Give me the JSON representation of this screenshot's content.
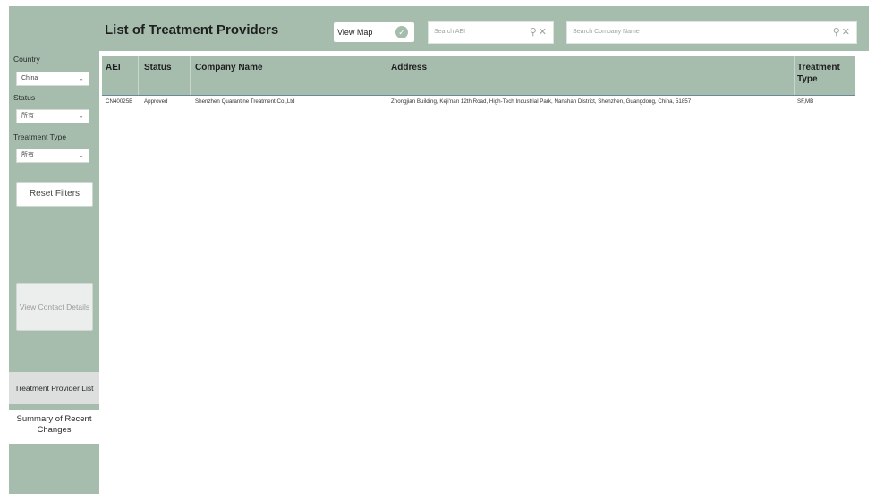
{
  "header": {
    "title": "List of Treatment Providers",
    "view_map_label": "View Map",
    "search_aei_placeholder": "Search AEI",
    "search_company_placeholder": "Search Company Name"
  },
  "sidebar": {
    "country_label": "Country",
    "country_value": "China",
    "status_label": "Status",
    "status_value": "所有",
    "treatment_type_label": "Treatment Type",
    "treatment_type_value": "所有",
    "reset_filters": "Reset Filters",
    "view_contact_details": "View Contact Details",
    "nav_provider_list": "Treatment Provider List",
    "nav_summary": "Summary of Recent Changes"
  },
  "table": {
    "columns": [
      "AEI",
      "Status",
      "Company Name",
      "Address",
      "Treatment Type"
    ],
    "rows": [
      {
        "aei": "CN40025B",
        "status": "Approved",
        "company": "Shenzhen Quarantine Treatment Co.,Ltd",
        "address": "Zhongjian Building, Keji'nan 12th Road, High-Tech Industrial Park, Nanshan District, Shenzhen, Guangdong, China, 51857",
        "treatment_type": "SF,MB"
      }
    ]
  },
  "colors": {
    "accent": "#a6bdae",
    "header_rule": "#6a8a9c"
  }
}
